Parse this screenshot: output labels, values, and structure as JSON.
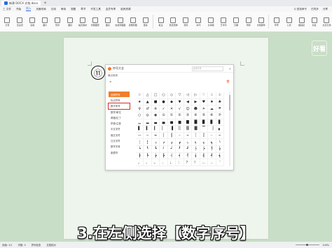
{
  "window": {
    "tab_title": "新建 DOCX 文档.docx",
    "plus_icon": "plus-icon"
  },
  "menu": {
    "items": [
      "三 文件",
      "开始",
      "插入",
      "页面布局",
      "引用",
      "审阅",
      "视图",
      "章节",
      "开发工具",
      "会员专享",
      "稻壳资源"
    ],
    "active_index": 2,
    "search_label": "Q 查找命令",
    "right_items": [
      "已同步",
      "分享"
    ]
  },
  "ribbon": {
    "buttons": [
      "分页",
      "空白页",
      "表格",
      "图片",
      "形状",
      "图标",
      "稻壳素材",
      "智能图形",
      "图表",
      "在线流程图",
      "思维导图",
      "更多",
      "批注",
      "页眉页脚",
      "页码",
      "水印",
      "文本框",
      "艺术字",
      "日期",
      "附件",
      "文档部件",
      "符号",
      "公式",
      "超链接",
      "书签",
      "交叉引用"
    ]
  },
  "dialog": {
    "title": "符号大全",
    "search_placeholder": "搜索符号",
    "close_glyph": "×",
    "subtitle": "最近使用",
    "recent_glyph": "∞",
    "trash_glyph": "🗑",
    "categories": [
      "全部符号",
      "标点符号",
      "数字序号",
      "数学/单位",
      "希腊/拉丁",
      "拼音/注音",
      "中文字符",
      "俄文字符",
      "日文字符",
      "数学字母",
      "制表符"
    ],
    "selected_index": 0,
    "highlight_index": 2,
    "symbols": [
      "☆",
      "△",
      "□",
      "○",
      "◇",
      "▽",
      "◁",
      "▷",
      "♡",
      "♤",
      "♧",
      "★",
      "▲",
      "■",
      "●",
      "◆",
      "▼",
      "◀",
      "▶",
      "♥",
      "♠",
      "♣",
      "♀",
      "♂",
      "※",
      "✓",
      "✕",
      "√",
      "☺",
      "☻",
      "☀",
      "☁",
      "☂",
      "○",
      "◎",
      "◉",
      "⊙",
      "①",
      "②",
      "③",
      "④",
      "⑤",
      "⑥",
      "⑦",
      "▁",
      "▂",
      "▃",
      "▄",
      "▅",
      "▆",
      "▇",
      "█",
      "▉",
      "▊",
      "▋",
      "▌",
      "▍",
      "▎",
      "▏",
      "▐",
      "░",
      "▒",
      "▓",
      "▔",
      "▕",
      "▖",
      "—",
      "─",
      "━",
      "│",
      "┃",
      "┄",
      "┅",
      "┆",
      "┇",
      "┈",
      "┉",
      "┊",
      "┋",
      "┌",
      "┍",
      "┎",
      "┏",
      "┐",
      "┑",
      "┒",
      "┓",
      "└",
      "┕",
      "┖",
      "┗",
      "┘",
      "┙",
      "┚",
      "┛",
      "├",
      "┝",
      "┞",
      "┟",
      "┠",
      "┡",
      "┢",
      "┣",
      "┤",
      "┥",
      "┦",
      "┧",
      "┨",
      "┩",
      "┪",
      "，",
      "、",
      "。",
      "．",
      "；",
      "：",
      "？",
      "！",
      "…",
      "‥",
      "¨"
    ]
  },
  "step_marker": "⑪",
  "caption": "3.在左侧选择【数字序号】",
  "watermark_logo": "好看",
  "status": {
    "items": [
      "页面: 1/1",
      "字数: 0",
      "拼写检查",
      "文档校对"
    ],
    "zoom": "100%"
  }
}
